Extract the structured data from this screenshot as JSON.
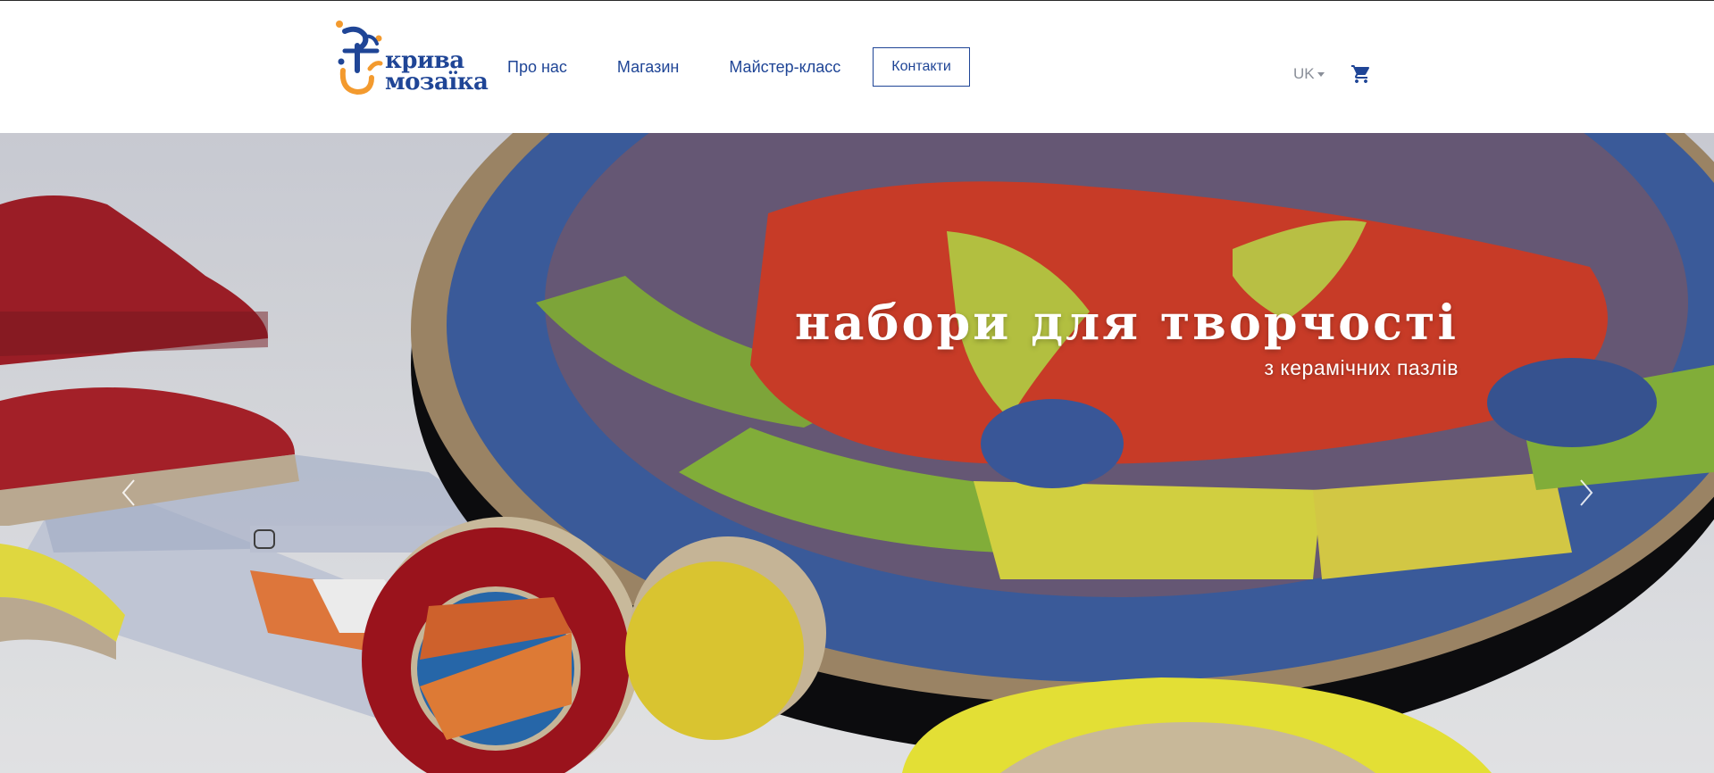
{
  "brand": {
    "name_line1": "крива",
    "name_line2": "мозаїка",
    "colors": {
      "blue": "#1f4596",
      "orange": "#f39a2e"
    }
  },
  "nav": {
    "items": [
      {
        "label": "Про нас"
      },
      {
        "label": "Магазин"
      },
      {
        "label": "Майстер-класс"
      }
    ],
    "contact_label": "Контакти"
  },
  "lang": {
    "current": "UK"
  },
  "icons": {
    "cart": "cart-icon",
    "prev": "chevron-left-icon",
    "next": "chevron-right-icon"
  },
  "hero": {
    "title": "набори для творчості",
    "subtitle": "з керамічних пазлів"
  }
}
